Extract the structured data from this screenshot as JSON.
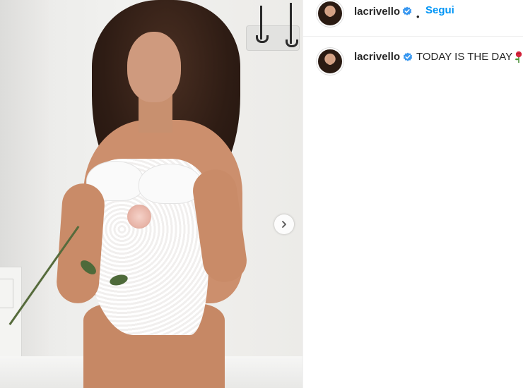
{
  "post": {
    "next_button_icon": "chevron-right-icon"
  },
  "header": {
    "username": "lacrivello",
    "separator": "•",
    "follow_label": "Segui",
    "verified_icon": "verified-badge-icon"
  },
  "caption": {
    "username": "lacrivello",
    "text": "TODAY IS THE DAY",
    "emoji_icon": "rose-emoji-icon"
  },
  "colors": {
    "follow": "#0095f6",
    "verified": "#3897f0",
    "text": "#262626"
  }
}
